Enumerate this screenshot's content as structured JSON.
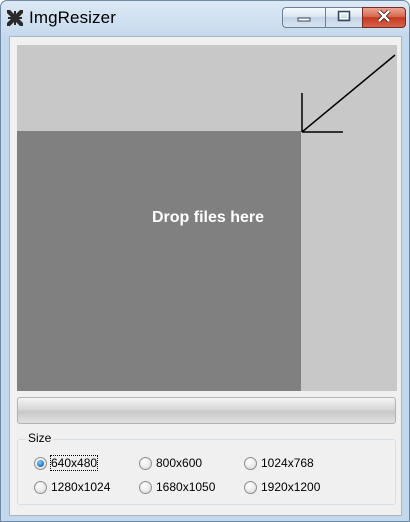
{
  "window": {
    "title": "ImgResizer",
    "icons": {
      "app": "compress-arrows-icon",
      "minimize": "minimize-icon",
      "maximize": "maximize-icon",
      "close": "close-icon"
    }
  },
  "drop_area": {
    "text": "Drop files here",
    "arrow_icon": "arrow-down-left-icon"
  },
  "progress": {
    "value": 0
  },
  "size_group": {
    "label": "Size",
    "selected": "640x480",
    "options": [
      "640x480",
      "800x600",
      "1024x768",
      "1280x1024",
      "1680x1050",
      "1920x1200"
    ]
  },
  "colors": {
    "drop_background": "#c8c8c8",
    "drop_target": "#808080",
    "close_button": "#c53a20",
    "radio_checked": "#1b6fc4"
  }
}
